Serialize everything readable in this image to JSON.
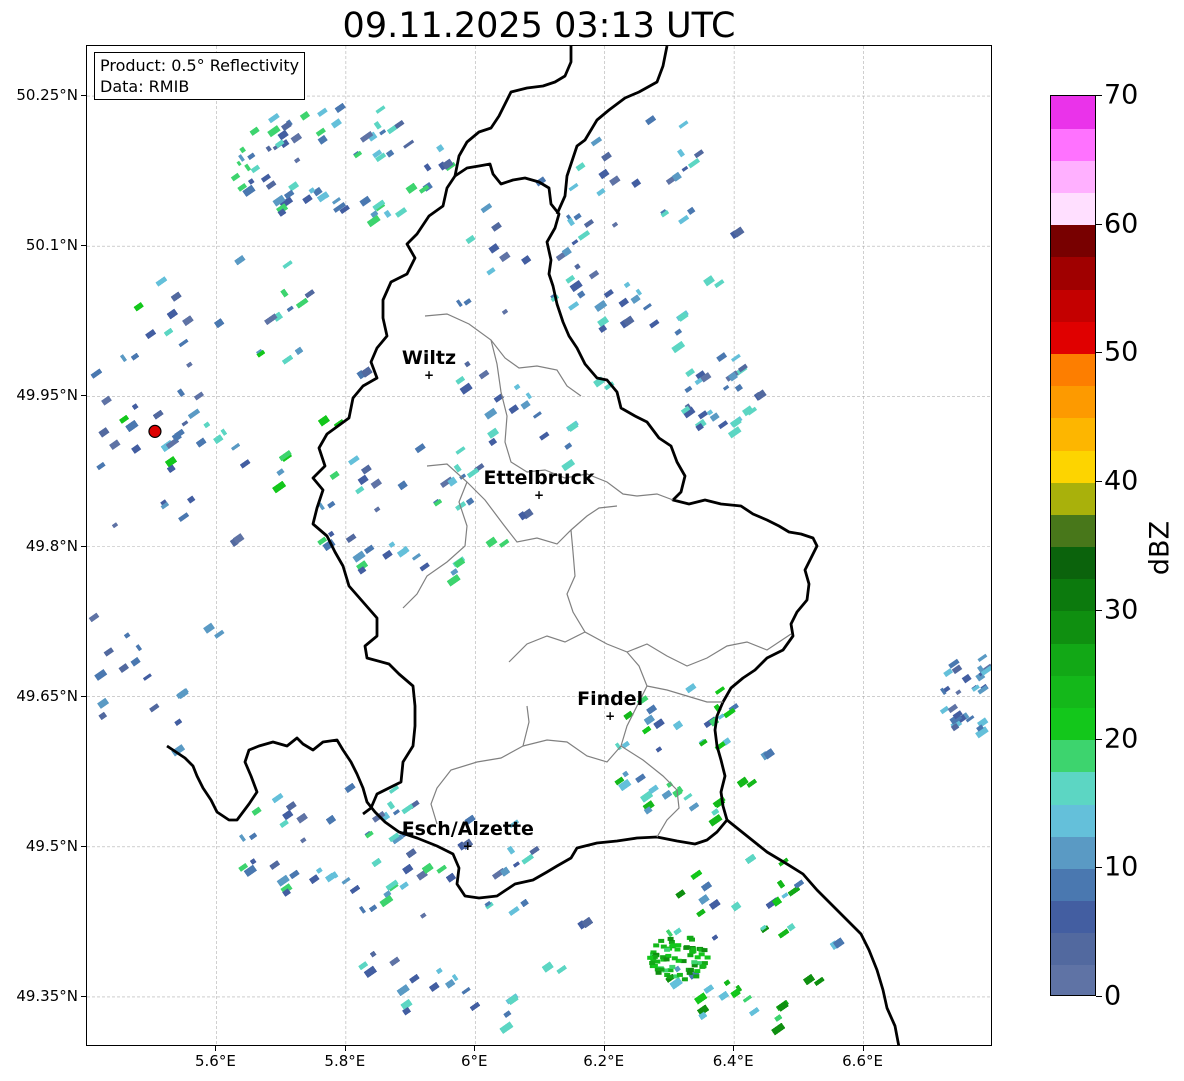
{
  "title": "09.11.2025 03:13 UTC",
  "info": {
    "product": "Product: 0.5° Reflectivity",
    "data": "Data: RMIB"
  },
  "lat_labels": [
    {
      "text": "50.25°N",
      "value": 50.25
    },
    {
      "text": "50.1°N",
      "value": 50.1
    },
    {
      "text": "49.95°N",
      "value": 49.95
    },
    {
      "text": "49.8°N",
      "value": 49.8
    },
    {
      "text": "49.65°N",
      "value": 49.65
    },
    {
      "text": "49.5°N",
      "value": 49.5
    },
    {
      "text": "49.35°N",
      "value": 49.35
    }
  ],
  "lon_labels": [
    {
      "text": "5.6°E",
      "value": 5.6
    },
    {
      "text": "5.8°E",
      "value": 5.8
    },
    {
      "text": "6°E",
      "value": 6.0
    },
    {
      "text": "6.2°E",
      "value": 6.2
    },
    {
      "text": "6.4°E",
      "value": 6.4
    },
    {
      "text": "6.6°E",
      "value": 6.6
    }
  ],
  "extent": {
    "lon_min": 5.4,
    "lon_max": 6.8,
    "lat_min": 49.3,
    "lat_max": 50.3
  },
  "cities": [
    {
      "name": "Wiltz",
      "lon": 5.93,
      "lat": 49.97
    },
    {
      "name": "Ettelbruck",
      "lon": 6.1,
      "lat": 49.85
    },
    {
      "name": "Findel",
      "lon": 6.21,
      "lat": 49.63
    },
    {
      "name": "Esch/Alzette",
      "lon": 5.99,
      "lat": 49.5
    }
  ],
  "radar_site": {
    "lon": 5.505,
    "lat": 49.915,
    "color": "#dd0000"
  },
  "colorbar": {
    "unit": "dBZ",
    "min": 0,
    "max": 70,
    "ticks": [
      {
        "text": "0",
        "value": 0
      },
      {
        "text": "10",
        "value": 10
      },
      {
        "text": "20",
        "value": 20
      },
      {
        "text": "30",
        "value": 30
      },
      {
        "text": "40",
        "value": 40
      },
      {
        "text": "50",
        "value": 50
      },
      {
        "text": "60",
        "value": 60
      },
      {
        "text": "70",
        "value": 70
      }
    ],
    "colors": [
      "#5f73a5",
      "#52699f",
      "#435ea1",
      "#4a78b0",
      "#5a9ac4",
      "#64c0da",
      "#5cd6c3",
      "#3dd46e",
      "#13c71b",
      "#14b81a",
      "#12a816",
      "#0f8f10",
      "#0c7a0d",
      "#0b630c",
      "#48771a",
      "#a9b10b",
      "#fdd400",
      "#fdb600",
      "#fd9a00",
      "#fd7e00",
      "#e00000",
      "#c40000",
      "#a00000",
      "#780000",
      "#ffdfff",
      "#ffb0ff",
      "#ff72ff",
      "#ea33ea"
    ]
  },
  "map_colors": {
    "country_border": "#000000",
    "district_border": "#808080",
    "grid": "#b0b0b0"
  }
}
